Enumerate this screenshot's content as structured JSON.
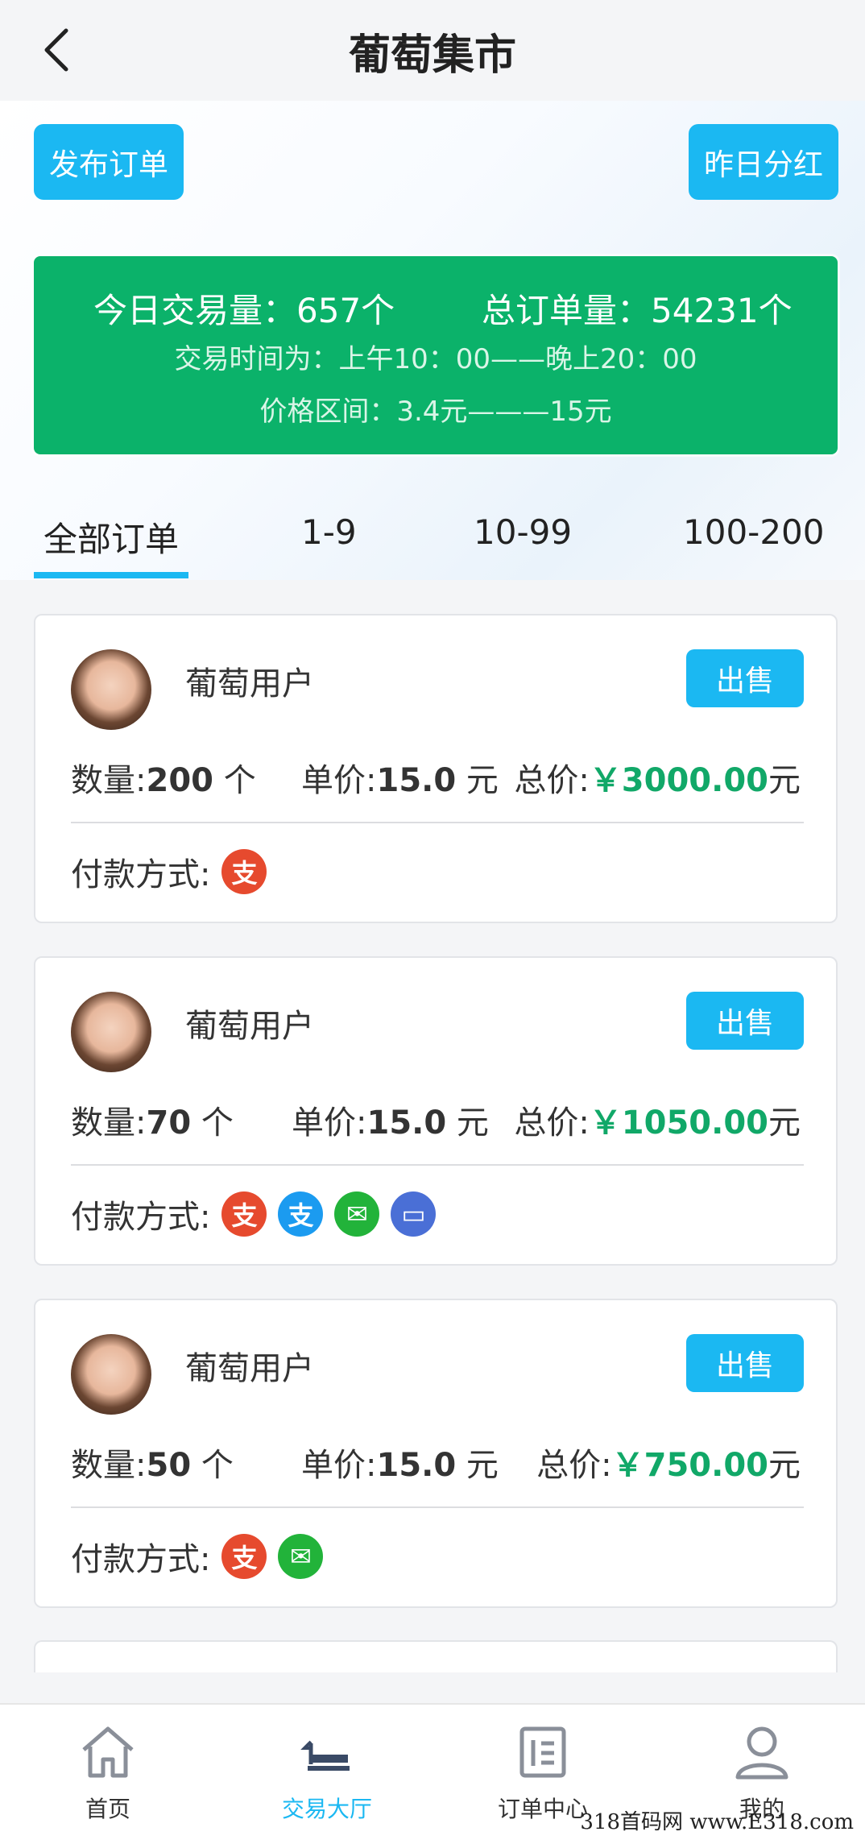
{
  "header": {
    "title": "葡萄集市",
    "back_icon": "back-arrow-icon"
  },
  "actions": {
    "publish_label": "发布订单",
    "dividend_label": "昨日分红"
  },
  "stats": {
    "today_volume": "今日交易量：657个",
    "total_orders": "总订单量：54231个",
    "trade_time": "交易时间为：上午10：00——晚上20：00",
    "price_range": "价格区间：3.4元———15元"
  },
  "tabs": [
    {
      "label": "全部订单",
      "active": true
    },
    {
      "label": "1-9"
    },
    {
      "label": "10-99"
    },
    {
      "label": "100-200"
    }
  ],
  "orders": [
    {
      "user": "葡萄用户",
      "sell_label": "出售",
      "qty_label": "数量:",
      "qty": "200",
      "qty_unit": " 个",
      "price_label": "单价:",
      "price": "15.0",
      "price_unit": " 元",
      "total_label": "总价:",
      "total": "￥3000.00",
      "total_unit": "元",
      "pay_label": "付款方式:",
      "pay_methods": [
        "pay-red"
      ]
    },
    {
      "user": "葡萄用户",
      "sell_label": "出售",
      "qty_label": "数量:",
      "qty": "70",
      "qty_unit": " 个",
      "price_label": "单价:",
      "price": "15.0",
      "price_unit": " 元",
      "total_label": "总价:",
      "total": "￥1050.00",
      "total_unit": "元",
      "pay_label": "付款方式:",
      "pay_methods": [
        "pay-red",
        "alipay",
        "wechat",
        "bank-card"
      ]
    },
    {
      "user": "葡萄用户",
      "sell_label": "出售",
      "qty_label": "数量:",
      "qty": "50",
      "qty_unit": " 个",
      "price_label": "单价:",
      "price": "15.0",
      "price_unit": " 元",
      "total_label": "总价:",
      "total": "￥750.00",
      "total_unit": "元",
      "pay_label": "付款方式:",
      "pay_methods": [
        "pay-red",
        "wechat"
      ]
    }
  ],
  "pay_glyphs": {
    "pay-red": "支",
    "alipay": "支",
    "wechat": "✉",
    "bank-card": "▭"
  },
  "colors": {
    "accent": "#1bb8f2",
    "stats_bg": "#0bb26a",
    "price_green": "#11a868",
    "pay_red": "#e64a2e",
    "alipay": "#1b9bf0",
    "wechat": "#22b33a",
    "bank_card": "#4a6fd6"
  },
  "nav": [
    {
      "label": "首页",
      "icon": "home-icon"
    },
    {
      "label": "交易大厅",
      "icon": "trade-hall-icon",
      "active": true
    },
    {
      "label": "订单中心",
      "icon": "order-center-icon"
    },
    {
      "label": "我的",
      "icon": "profile-icon"
    }
  ],
  "watermark": "318首码网  www.E318.com"
}
